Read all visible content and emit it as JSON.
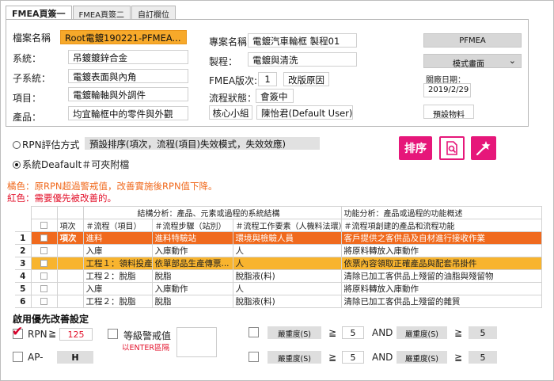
{
  "tabs": [
    "FMEA頁簽一",
    "FMEA頁簽二",
    "自訂欄位"
  ],
  "header": {
    "file_name_label": "檔案名稱",
    "file_name": "Root電鍍190221-PFMEA...",
    "system_label": "系統：",
    "system": "吊鍍鍍鋅合金",
    "subsystem_label": "子系統：",
    "subsystem": "電鍍表面與內角",
    "item_label": "項目：",
    "item": "電鍍輪軸與外調件",
    "product_label": "產品：",
    "product": "均宜輪框中的零件與外觀",
    "project_label": "專案名稱",
    "project": "電鍍汽車輪框 製程01",
    "process_label": "製程：",
    "process": "電鍍與清洗",
    "version_label": "FMEA版次:",
    "version": "1",
    "change_reason": "改版原因",
    "flow_status_label": "流程狀態：",
    "flow_status": "會簽中",
    "core_team": "核心小組",
    "owner": "陳怡君(Default User)",
    "pfmea_button": "PFMEA",
    "mode_select": "模式畫面",
    "close_date_label": "關廠日期：",
    "close_date": "2019/2/29",
    "forecast_button": "預設物料"
  },
  "rpn": {
    "method_label": "RPN評估方式",
    "sort_method": "預設排序(項次，流程(項目)失效模式，失效效應)",
    "system_default_label": "系統Deafault＃可夾附檔",
    "sort_button": "排序",
    "note_orange": "橘色：原RPN超過警戒值，改善實施後RPN值下降。",
    "note_red": "紅色：需要優先被改善的。"
  },
  "table": {
    "group_headers": [
      "結構分析：產品、元素或過程的系統結構",
      "功能分析：產品或過程的功能概述"
    ],
    "columns": [
      "項次",
      "＃流程（項目）",
      "＃流程步驟（站別）",
      "＃流程工作要素（人機料法環）",
      "＃流程項創建的產品和流程功能"
    ],
    "rows": [
      {
        "num": "1",
        "item": "項次",
        "flow": "進料",
        "step": "進料特驗站",
        "element": "環境與檢驗人員",
        "function": "客戶提供之客供品及自材進行接收作業",
        "style": "orange"
      },
      {
        "num": "2",
        "item": "",
        "flow": "入庫",
        "step": "入庫動作",
        "element": "人",
        "function": "將原料轉放入庫動作",
        "style": ""
      },
      {
        "num": "3",
        "item": "",
        "flow": "工程１：領料投產",
        "step": "依單部品生產傳票...",
        "element": "人",
        "function": "依票內容領取正確產品與配套吊掛件",
        "style": "yellow"
      },
      {
        "num": "4",
        "item": "",
        "flow": "工程２：脫脂",
        "step": "脫脂",
        "element": "脫脂液(料)",
        "function": "清除已加工客供品上殘留的油脂與殘留物",
        "style": ""
      },
      {
        "num": "5",
        "item": "",
        "flow": "入庫",
        "step": "入庫動作",
        "element": "人",
        "function": "將原料轉放入庫動作",
        "style": ""
      },
      {
        "num": "6",
        "item": "",
        "flow": "工程２：脫脂",
        "step": "脫脂",
        "element": "脫脂液(料)",
        "function": "清除已加工客供品上殘留的雜質",
        "style": ""
      }
    ]
  },
  "priority": {
    "title": "啟用優先改善設定",
    "rpn_label": "RPN",
    "ge": "≧",
    "rpn_value": "125",
    "level_label": "等級警戒值",
    "enter_hint": "以ENTER區隔",
    "ap_label": "AP-",
    "ap_value": "H",
    "severity_label": "嚴重度(S)",
    "threshold_1": "5",
    "and_label": "AND",
    "threshold_2": "5",
    "threshold_3": "5",
    "threshold_4": "5"
  },
  "colors": {
    "highlight_orange": "#f06a1e",
    "highlight_yellow": "#f8b42e",
    "accent_pink": "#e6177a",
    "note_orange_text": "#f06a1e",
    "note_red_text": "#e3122b"
  }
}
